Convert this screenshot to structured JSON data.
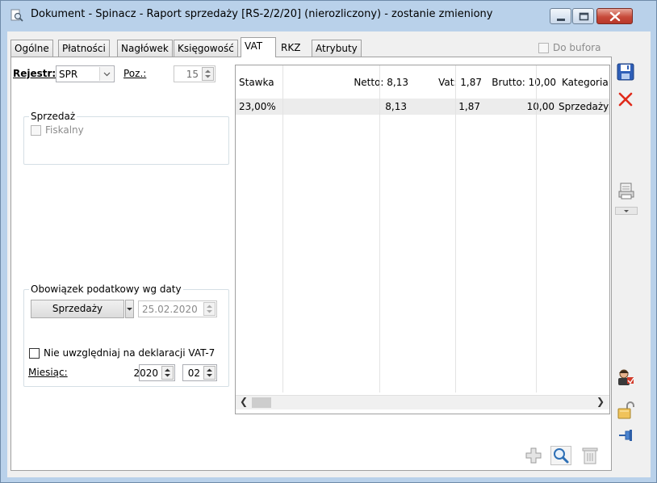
{
  "window": {
    "title": "Dokument - Spinacz - Raport sprzedaży [RS-2/2/20] (nierozliczony) - zostanie zmieniony"
  },
  "tabs": [
    {
      "label": "Ogólne"
    },
    {
      "label": "Płatności"
    },
    {
      "label": "Nagłówek"
    },
    {
      "label": "Księgowość"
    },
    {
      "label": "VAT"
    },
    {
      "label": "RKZ"
    },
    {
      "label": "Atrybuty"
    }
  ],
  "do_bufora": {
    "label": "Do bufora",
    "checked": false
  },
  "form": {
    "rejestr_label": "Rejestr:",
    "rejestr_value": "SPR",
    "poz_label": "Poz.:",
    "poz_value": "15",
    "sprzedaz_group": "Sprzedaż",
    "fiskalny_label": "Fiskalny",
    "obowiazek_group": "Obowiązek podatkowy wg daty",
    "obowiazek_button": "Sprzedaży",
    "obowiazek_date": "25.02.2020",
    "nie_uwzgledniaj_label": "Nie uwzględniaj na deklaracji VAT-7",
    "miesiac_label": "Miesiąc:",
    "miesiac_year": "2020",
    "miesiac_month": "02"
  },
  "table": {
    "columns": [
      "Stawka",
      "Netto: 8,13",
      "Vat: 1,87",
      "Brutto: 10,00",
      "Kategoria"
    ],
    "rows": [
      [
        "23,00%",
        "8,13",
        "1,87",
        "10,00",
        "Sprzedaży"
      ]
    ]
  },
  "icons": {
    "save": "save-icon",
    "cancel": "close-icon",
    "print": "print-icon",
    "contractor": "contractor-icon",
    "unlock": "lock-icon",
    "pin": "pin-icon",
    "add": "plus-icon",
    "view": "search-icon",
    "delete": "trash-icon"
  },
  "colors": {
    "titlebar": "#b9d1ea",
    "close_red": "#c74a3a",
    "save_blue": "#2f5fb8",
    "cancel_red": "#e02a1a"
  }
}
